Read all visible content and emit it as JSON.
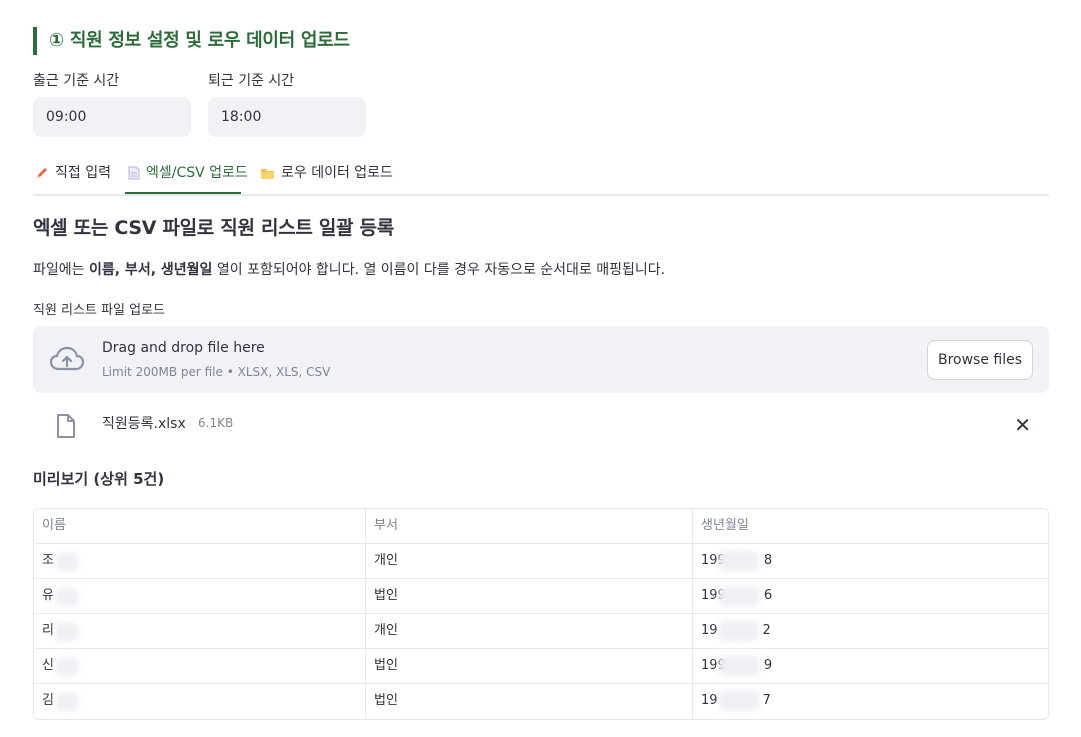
{
  "section": {
    "title": "① 직원 정보 설정 및 로우 데이터 업로드"
  },
  "time_settings": {
    "checkin_label": "출근 기준 시간",
    "checkin_value": "09:00",
    "checkout_label": "퇴근 기준 시간",
    "checkout_value": "18:00"
  },
  "tabs": [
    {
      "label": "직접 입력",
      "icon": "pencil-icon"
    },
    {
      "label": "엑셀/CSV 업로드",
      "icon": "document-icon",
      "active": true
    },
    {
      "label": "로우 데이터 업로드",
      "icon": "folder-icon"
    }
  ],
  "upload_section": {
    "heading": "엑셀 또는 CSV 파일로 직원 리스트 일괄 등록",
    "desc_prefix": "파일에는 ",
    "desc_bold": "이름, 부서, 생년월일",
    "desc_suffix": " 열이 포함되어야 합니다. 열 이름이 다를 경우 자동으로 순서대로 매핑됩니다.",
    "uploader_label": "직원 리스트 파일 업로드",
    "drop_main": "Drag and drop file here",
    "drop_sub": "Limit 200MB per file • XLSX, XLS, CSV",
    "browse_label": "Browse files",
    "accent_color": "#2e6b3a"
  },
  "uploaded_file": {
    "name": "직원등록.xlsx",
    "size": "6.1KB"
  },
  "preview": {
    "heading": "미리보기 (상위 5건)",
    "columns": [
      "이름",
      "부서",
      "생년월일"
    ],
    "rows": [
      [
        "조",
        "개인",
        "199",
        "8"
      ],
      [
        "유",
        "법인",
        "199",
        "6"
      ],
      [
        "리",
        "개인",
        "19",
        "2"
      ],
      [
        "신",
        "법인",
        "199",
        "9"
      ],
      [
        "김",
        "법인",
        "19",
        "7"
      ]
    ]
  }
}
